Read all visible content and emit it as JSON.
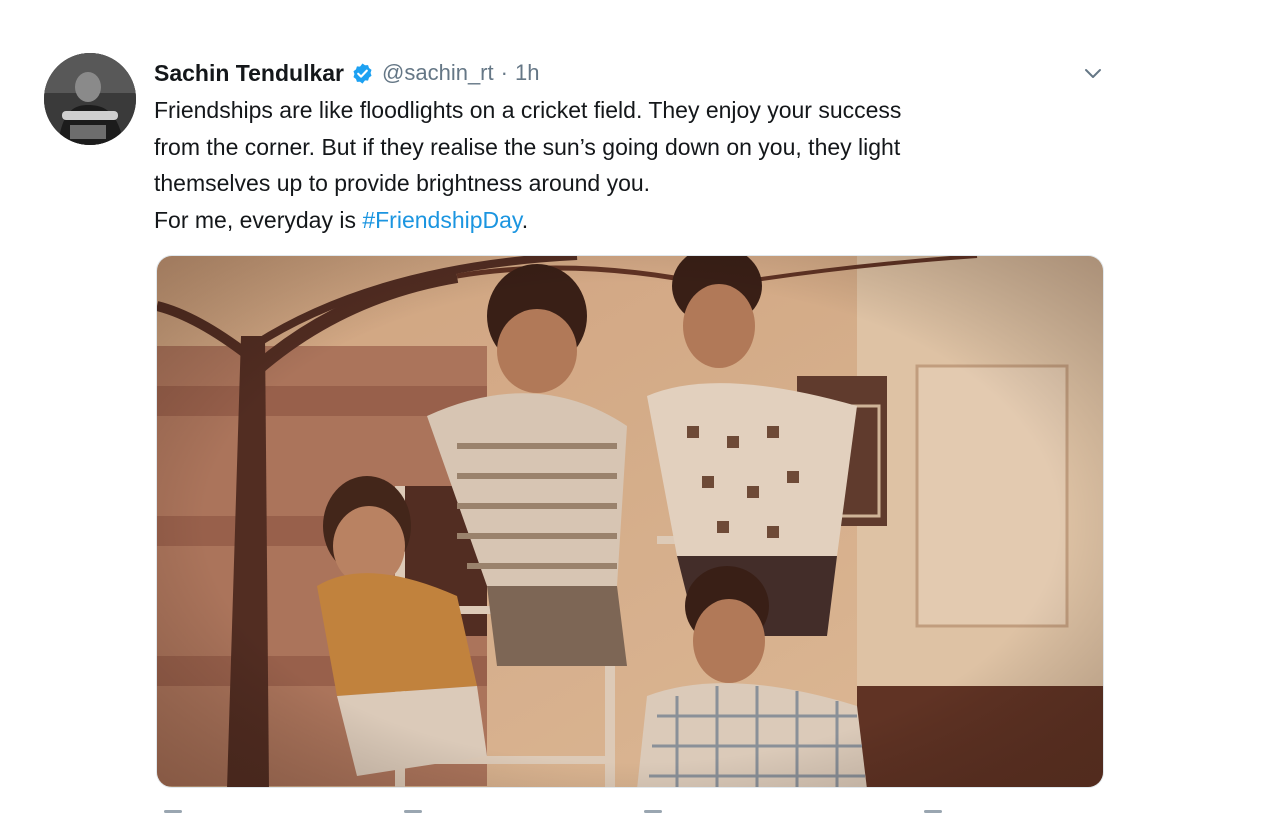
{
  "tweet": {
    "author_name": "Sachin Tendulkar",
    "handle": "@sachin_rt",
    "separator": "·",
    "time": "1h",
    "verified": true,
    "verified_badge_color": "#1da1f2",
    "text_lines": [
      "Friendships are like floodlights on a cricket field. They enjoy your success",
      "from the corner. But if they realise the sun’s going down on you, they light",
      "themselves up to provide brightness around you."
    ],
    "last_line_prefix": "For me, everyday is ",
    "hashtag": "#FriendshipDay",
    "last_line_suffix": ".",
    "hashtag_color": "#1b95e0",
    "caret_icon": "chevron-down-icon",
    "media": {
      "kind": "photo",
      "style": "sepia vintage photograph"
    }
  }
}
